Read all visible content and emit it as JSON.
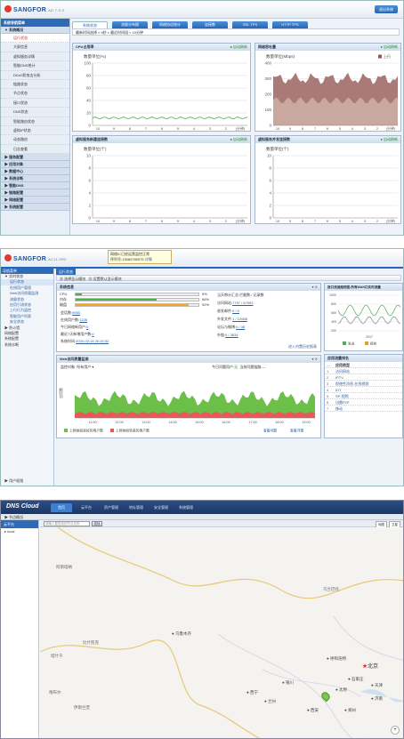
{
  "p1": {
    "brand": "SANGFOR",
    "version": "AD 7.0.3",
    "top_right_button": "退出系统",
    "sidebar_title": "系统导航菜单",
    "sidebar_groups": [
      "▼ 系统概况",
      "▶ 服务配置",
      "▶ 应用对象",
      "▶ 数据中心",
      "▶ 系统诊断",
      "▶ 智能DNS",
      "▶ 链路配置",
      "▶ 网络配置",
      "▶ 系统配置"
    ],
    "sidebar_items": [
      "运行状态",
      "大屏信息",
      "虚拟服务详情",
      "智能DNS统计",
      "DDoS防攻击分析",
      "链路状态",
      "节点状态",
      "接口状态",
      "DNS状态",
      "智能路由状态",
      "虚拟IP状态",
      "动态路由",
      "日志查看"
    ],
    "tabs": [
      "系统状态",
      "流量分布图",
      "网络协议统计",
      "连接数",
      "SSL TPS",
      "HTTP TPS"
    ],
    "breadcrumb": "最新时间选择 » 5秒 » 最近时间段 » 10分钟",
    "boxes": [
      {
        "title": "CPU占用率",
        "auto": "自动刷新",
        "unit": "数量单位(%)",
        "y_ticks": [
          "100",
          "80",
          "60",
          "40",
          "20",
          "0"
        ],
        "x_ticks": [
          "10",
          "9",
          "8",
          "7",
          "6",
          "5",
          "4",
          "3",
          "2",
          "1"
        ],
        "x_unit": "(分钟)"
      },
      {
        "title": "网络吞吐量",
        "auto": "自动刷新",
        "unit": "数量单位(Mbps)",
        "legend": "上行",
        "y_ticks": [
          "400",
          "300",
          "200",
          "100",
          "0"
        ],
        "x_ticks": [
          "10",
          "9",
          "8",
          "7",
          "6",
          "5",
          "4",
          "3",
          "2",
          "1"
        ],
        "x_unit": "(分钟)"
      },
      {
        "title": "虚拟服务新建连接数",
        "auto": "自动刷新",
        "unit": "数量单位(个)",
        "y_ticks": [
          "10",
          "8",
          "6",
          "4",
          "2",
          "0"
        ],
        "x_ticks": [
          "10",
          "9",
          "8",
          "7",
          "6",
          "5",
          "4",
          "3",
          "2",
          "1"
        ],
        "x_unit": "(分钟)"
      },
      {
        "title": "虚拟服务并发连接数",
        "auto": "自动刷新",
        "unit": "数量单位(个)",
        "y_ticks": [
          "10",
          "8",
          "6",
          "4",
          "2",
          "0"
        ],
        "x_ticks": [
          "10",
          "9",
          "8",
          "7",
          "6",
          "5",
          "4",
          "3",
          "2",
          "1"
        ],
        "x_unit": "(分钟)"
      }
    ],
    "cpu_line_pct": 12,
    "throughput_band_mbps": [
      300,
      100
    ]
  },
  "p2": {
    "brand": "SANGFOR",
    "model": "AC11.9R0",
    "tip_line1": "网络IC已经运营监控正常",
    "tip_line2": "序列号:13584785575",
    "tip_link": "详情",
    "sidebar_title": "导航菜单",
    "sidebar_items": [
      {
        "label": "▼ 实时状态",
        "top": true
      },
      {
        "label": "运行状态",
        "top": false
      },
      {
        "label": "在线用户管理",
        "top": false
      },
      {
        "label": "Web访问质量监测",
        "top": false
      },
      {
        "label": "流量状态",
        "top": false
      },
      {
        "label": "应用引流状态",
        "top": false
      },
      {
        "label": "上行行为监控",
        "top": false
      },
      {
        "label": "智能用户列表",
        "top": false
      },
      {
        "label": "安全状态",
        "top": false
      },
      {
        "label": "▶ 防火墙",
        "top": true
      },
      {
        "label": "网络配置",
        "top": true
      },
      {
        "label": "系统配置",
        "top": true
      },
      {
        "label": "系统诊断",
        "top": true
      }
    ],
    "sidebar_footer": "▶ 用户权限",
    "tab": "运行状态",
    "toolbar": [
      "选择显示模块",
      "设置默认显示模块"
    ],
    "sys_title": "系统信息",
    "bars": [
      {
        "label": "CPU",
        "pct": 5,
        "color": "#4caf50",
        "text": "5%"
      },
      {
        "label": "内存",
        "pct": 66,
        "color": "#4caf50",
        "text": "66%"
      },
      {
        "label": "磁盘",
        "pct": 92,
        "color": "#f5a623",
        "text": "92%"
      }
    ],
    "kv_left": [
      {
        "k": "会话数:",
        "v": "9953"
      },
      {
        "k": "在线用户数:",
        "v": "1226"
      },
      {
        "k": "今日网络新用户:",
        "v": "0"
      },
      {
        "k": "最近7天新增用户数:",
        "v": "0"
      },
      {
        "k": "系统时间:",
        "v": "2020-02-15 20:20:32"
      }
    ],
    "kv_right": [
      {
        "k": "当天审计汇总:",
        "v": "拦截数 / 记录数"
      },
      {
        "k": "访问网站:",
        "v": "7797 / 67993"
      },
      {
        "k": "收发邮件:",
        "v": "0 / 0"
      },
      {
        "k": "外发文件:",
        "v": "1 / 12088"
      },
      {
        "k": "论坛与微博:",
        "v": "0 / 38"
      },
      {
        "k": "外链:",
        "v": "0 / 3834"
      }
    ],
    "sys_footer": "进入内置历史报表",
    "web_title": "Web访问质量监测",
    "web_left": "监控对象:",
    "web_left_val": "所有用户",
    "web_right1": "今日问题用户:",
    "web_right1_val": "无",
    "web_right2": "当前问题链路:",
    "web_right2_val": "—",
    "web_y": "应用数",
    "web_x_ticks": [
      "11:00",
      "12:00",
      "13:00",
      "14:00",
      "15:00",
      "16:00",
      "17:00",
      "18:00",
      "19:00"
    ],
    "web_legend": [
      "上网体验良好的用户数",
      "上网体验较差的用户数"
    ],
    "web_links": [
      "查看问题",
      "查看详情"
    ],
    "flow_title": "接口流速趋势图-所有WAN口实时流量",
    "flow_y": [
      "1000",
      "800",
      "600",
      "400",
      "200"
    ],
    "flow_x": "2017",
    "flow_legend": [
      "发送",
      "接收"
    ],
    "apps_title": "应用流量排名",
    "apps_header": "应用类型",
    "apps": [
      "访问网站",
      "IPTV",
      "即使性消息-在线视频",
      "IDT",
      "SP-视频",
      "迅雷P2P",
      "移动"
    ]
  },
  "p3": {
    "brand": "DNS Cloud",
    "nav": [
      "首页",
      "云平台",
      "资产管理",
      "地址管理",
      "安全管理",
      "系统管理"
    ],
    "sub": "▶ 节点概况",
    "side_title": "云平台",
    "side_item": "▸ local",
    "search_placeholder": "请输入要查找的节点名称",
    "search_button": "查找",
    "map_controls": [
      "地图",
      "卫星"
    ],
    "regions": [
      "阿斯塔纳",
      "乌兰巴托",
      "比什凯克",
      "塔什干",
      "喀布尔",
      "伊斯兰堡",
      "乌鲁木齐",
      "呼和浩特",
      "北京",
      "石家庄",
      "天津",
      "太原",
      "银川",
      "兰州",
      "西宁",
      "西安",
      "郑州",
      "济南"
    ]
  }
}
